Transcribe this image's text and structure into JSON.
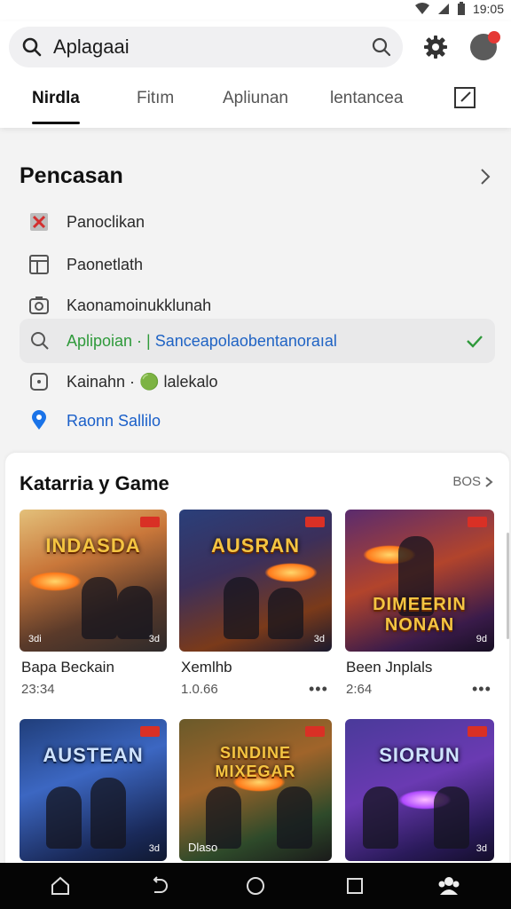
{
  "status_bar": {
    "time": "19:05",
    "icons": [
      "wifi-icon",
      "signal-icon",
      "battery-icon"
    ]
  },
  "search": {
    "value": "Aplagaai",
    "icons": [
      "search-icon",
      "search-icon",
      "gear-icon",
      "avatar"
    ]
  },
  "tabs": [
    {
      "label": "Nirdla",
      "active": true
    },
    {
      "label": "Fitım",
      "active": false
    },
    {
      "label": "Apliunan",
      "active": false
    },
    {
      "label": "lentancea",
      "active": false
    }
  ],
  "recent": {
    "title": "Pencasan",
    "items": [
      {
        "icon": "x-square-icon",
        "label": "Panoclikan"
      },
      {
        "icon": "layout-icon",
        "label": "Paonetlath"
      },
      {
        "icon": "camera-search-icon",
        "label": "Kaonamoinukklunah"
      },
      {
        "icon": "search-icon",
        "label_green": "Aplipoian · |",
        "label_blue": "Sanceapolaobentanoraıal",
        "selected": true
      },
      {
        "icon": "square-icon",
        "label": "Kainahn · 🟢 lalekalo"
      },
      {
        "icon": "location-pin-icon",
        "label": "Raonn Sallilo"
      }
    ]
  },
  "games": {
    "title": "Katarria y Game",
    "more_label": "BOS",
    "items": [
      {
        "art_title": "INDASDA",
        "name": "Bapa Beckain",
        "sub": "23:34",
        "corner_l": "3di",
        "corner_r": "3d"
      },
      {
        "art_title": "AUSRAN",
        "name": "Xemlhb",
        "sub": "1.0.66",
        "corner_l": "",
        "corner_r": "3d"
      },
      {
        "art_title": "DIMEERIN NONAN",
        "name": "Been Jnplals",
        "sub": "2:64",
        "corner_l": "",
        "corner_r": "9d"
      },
      {
        "art_title": "AUSTEAN",
        "name": "",
        "sub": "",
        "corner_l": "",
        "corner_r": "3d"
      },
      {
        "art_title": "SINDINE MIXEGAR",
        "name": "",
        "sub": "",
        "corner_l": "Dlaso",
        "corner_r": ""
      },
      {
        "art_title": "SIORUN",
        "name": "",
        "sub": "",
        "corner_l": "",
        "corner_r": "3d"
      }
    ]
  },
  "nav": {
    "icons": [
      "home-icon",
      "back-icon",
      "circle-home-icon",
      "recents-icon",
      "people-icon"
    ]
  },
  "colors": {
    "accent_green": "#2f9a3b",
    "accent_blue": "#1f63c4",
    "badge_red": "#d93025"
  }
}
